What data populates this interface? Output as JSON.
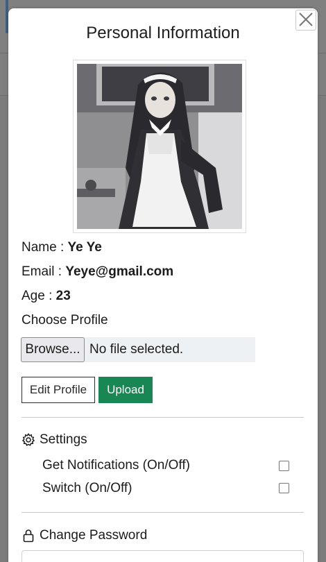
{
  "modal": {
    "title": "Personal Information",
    "close_icon": "close-icon"
  },
  "profile": {
    "name_label": "Name : ",
    "name_value": "Ye Ye",
    "email_label": "Email : ",
    "email_value": "Yeye@gmail.com",
    "age_label": "Age : ",
    "age_value": "23",
    "choose_label": "Choose Profile",
    "browse_label": "Browse...",
    "file_status": "No file selected.",
    "edit_label": "Edit Profile",
    "upload_label": "Upload"
  },
  "settings": {
    "icon": "gear-icon",
    "title": "Settings",
    "items": [
      {
        "label": "Get Notifications (On/Off)",
        "checked": false
      },
      {
        "label": "Switch (On/Off)",
        "checked": false
      }
    ]
  },
  "password": {
    "icon": "lock-icon",
    "title": "Change Password"
  },
  "colors": {
    "upload_green": "#198754",
    "backdrop": "#7d7d7d"
  }
}
